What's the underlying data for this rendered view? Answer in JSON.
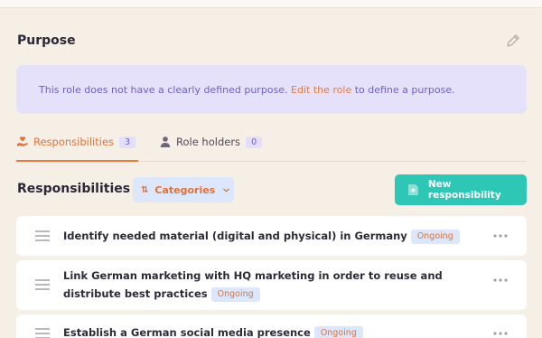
{
  "purpose": {
    "title": "Purpose",
    "edit_icon": "pencil-icon",
    "message_before": "This role does not have a clearly defined purpose. ",
    "message_link": "Edit the role",
    "message_after": " to define a purpose."
  },
  "tabs": {
    "responsibilities": {
      "label": "Responsibilities",
      "count": "3",
      "icon": "hand-heart-icon"
    },
    "role_holders": {
      "label": "Role holders",
      "count": "0",
      "icon": "person-icon"
    }
  },
  "responsibilities": {
    "heading": "Responsibilities",
    "count": "3",
    "categories_label": "Categories",
    "new_button_label": "New responsibility",
    "items": [
      {
        "title": "Identify needed material (digital and physical) in Germany",
        "status": "Ongoing"
      },
      {
        "title": "Link German marketing with HQ marketing in order to reuse and distribute best practices",
        "status": "Ongoing"
      },
      {
        "title": "Establish a German social media presence",
        "status": "Ongoing"
      }
    ]
  },
  "colors": {
    "background": "#f6efe6",
    "accent_orange": "#e8793b",
    "purple": "#6b5fd0",
    "teal": "#2ec6b4",
    "purpose_box": "#e6e1fa",
    "status_bg": "#dde7fb"
  }
}
